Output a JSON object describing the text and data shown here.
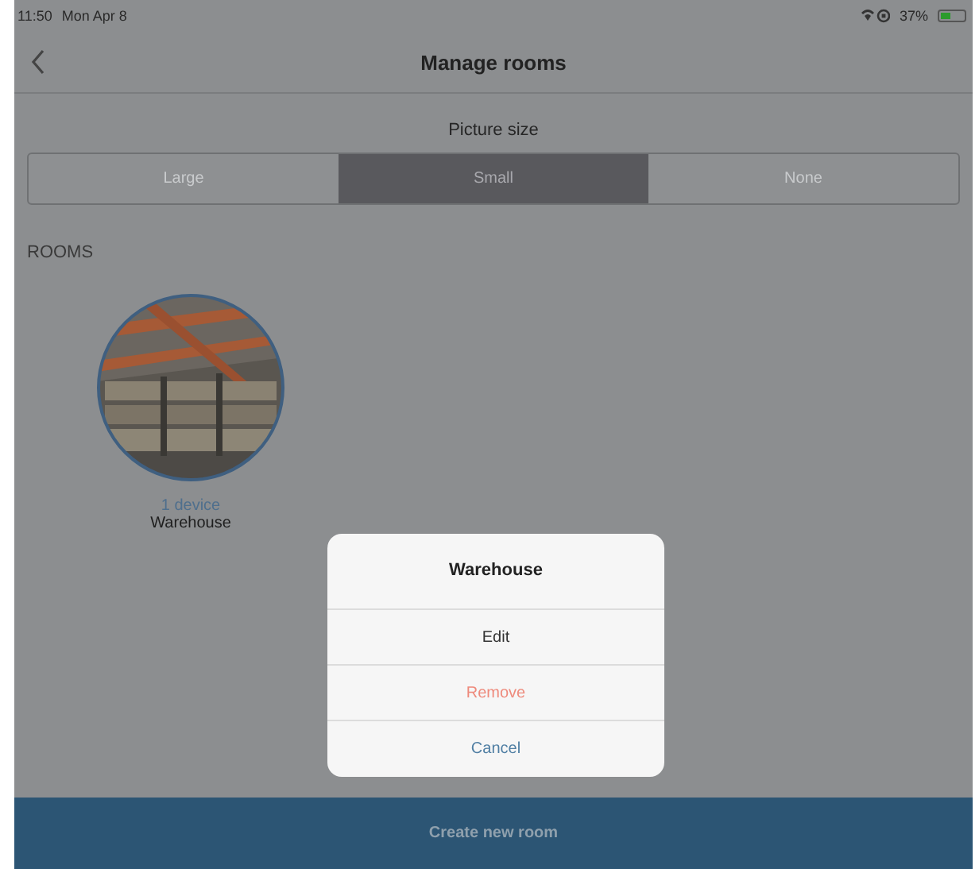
{
  "status_bar": {
    "time": "11:50",
    "date": "Mon Apr 8",
    "battery": "37%"
  },
  "nav": {
    "title": "Manage rooms"
  },
  "picture_size": {
    "label": "Picture size",
    "options": [
      {
        "label": "Large",
        "selected": false
      },
      {
        "label": "Small",
        "selected": true
      },
      {
        "label": "None",
        "selected": false
      }
    ]
  },
  "rooms": {
    "heading": "ROOMS",
    "items": [
      {
        "devices": "1 device",
        "name": "Warehouse",
        "kind": "picture"
      }
    ]
  },
  "dialog": {
    "title": "Warehouse",
    "actions": [
      {
        "label": "Edit",
        "kind": "default"
      },
      {
        "label": "Remove",
        "kind": "destructive"
      },
      {
        "label": "Cancel",
        "kind": "cancel"
      }
    ]
  },
  "footer": {
    "button": "Create new room"
  }
}
